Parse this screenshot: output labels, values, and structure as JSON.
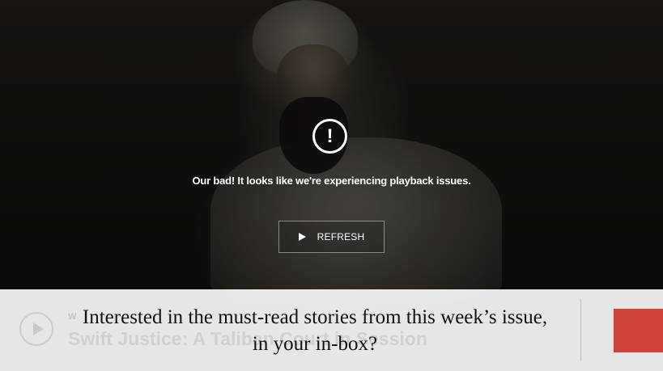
{
  "player": {
    "error_icon": "!",
    "error_message": "Our bad! It looks like we're experiencing playback issues.",
    "refresh_label": "REFRESH",
    "icons": {
      "error": "exclamation-circle-icon",
      "refresh": "play-icon"
    }
  },
  "video_underlay": {
    "kicker": "W",
    "title": "Swift Justice: A Taliban Court in Session"
  },
  "newsletter": {
    "prompt": "Interested in the must-read stories from this week’s issue, in your in-box?",
    "button_color": "#d0433a"
  }
}
